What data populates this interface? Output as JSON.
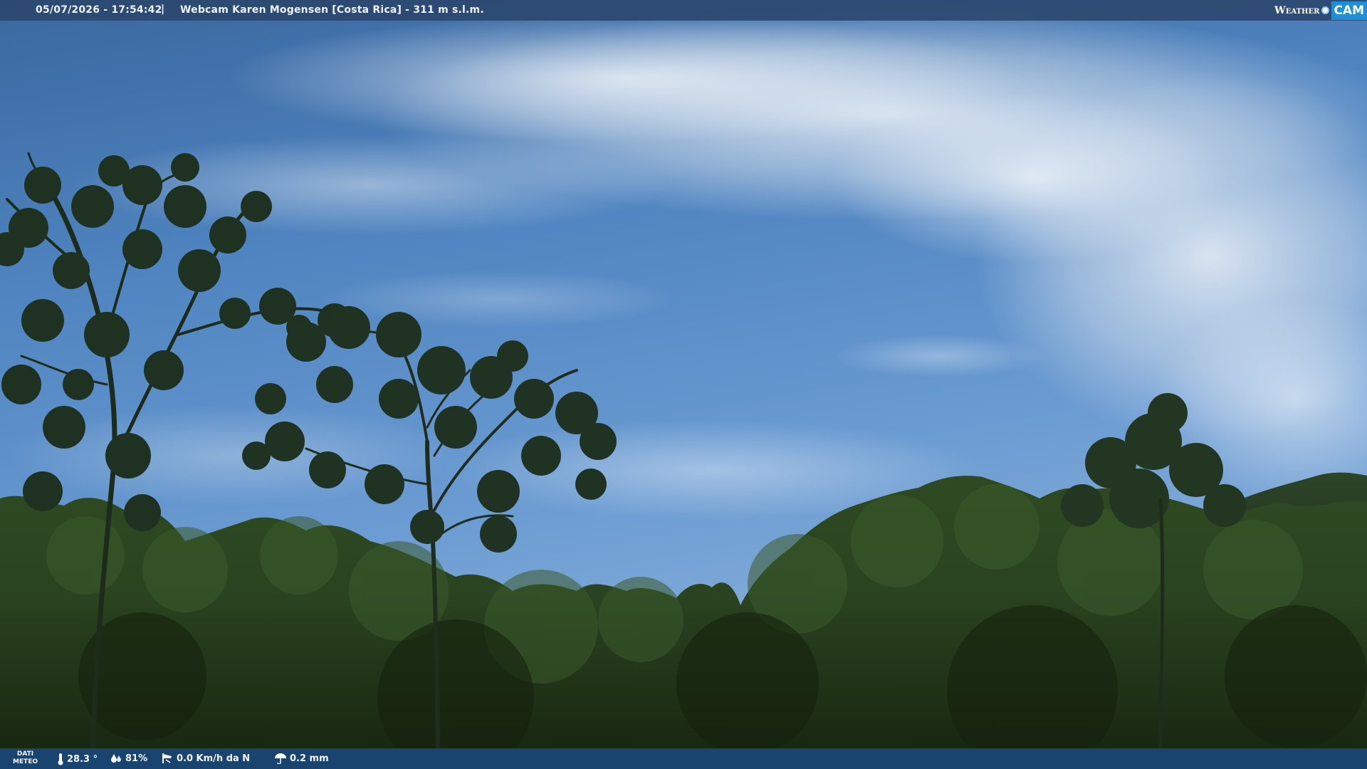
{
  "header": {
    "datetime": "05/07/2026 - 17:54:42",
    "separator": "|",
    "title": "Webcam Karen Mogensen [Costa Rica] - 311 m s.l.m."
  },
  "logo": {
    "weather_text": "Weather",
    "cam_text": "CAM"
  },
  "weather_bar": {
    "label_line1": "DATI",
    "label_line2": "METEO",
    "temperature": "28.3 °",
    "humidity": "81%",
    "wind": "0.0 Km/h da N",
    "rain": "0.2 mm"
  },
  "icons": {
    "temperature": "thermometer-icon",
    "humidity": "humidity-drops-icon",
    "wind": "wind-sock-icon",
    "rain": "rain-umbrella-icon"
  },
  "colors": {
    "top_bar": "#2b466c",
    "bottom_bar": "#18487a",
    "logo_accent": "#1f8fd6",
    "sky_top": "#3d6ea8",
    "sky_mid": "#5a8fcc",
    "foliage_dark": "#1c2a15"
  }
}
